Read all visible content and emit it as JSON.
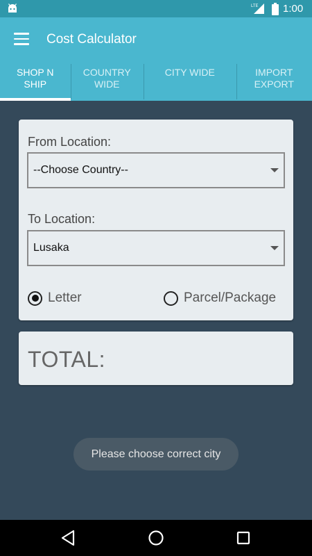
{
  "status_bar": {
    "network": "LTE",
    "time": "1:00"
  },
  "app_bar": {
    "title": "Cost Calculator"
  },
  "tabs": [
    {
      "label": "SHOP N SHIP",
      "active": true
    },
    {
      "label": "COUNTRY WIDE",
      "active": false
    },
    {
      "label": "CITY WIDE",
      "active": false
    },
    {
      "label": "IMPORT EXPORT",
      "active": false
    }
  ],
  "form": {
    "from_label": "From Location:",
    "from_value": "--Choose Country--",
    "to_label": "To Location:",
    "to_value": "Lusaka",
    "radio_letter": "Letter",
    "radio_parcel": "Parcel/Package",
    "selected": "Letter"
  },
  "total": {
    "label": "TOTAL:"
  },
  "toast": {
    "message": "Please choose correct city"
  },
  "colors": {
    "primary": "#4ab7cf",
    "status_bar": "#2f98ab",
    "background": "#34495a",
    "card": "#e8edf0"
  },
  "icons": {
    "status": [
      "android-icon",
      "lte-signal-icon",
      "battery-icon"
    ],
    "app_bar": [
      "menu-icon"
    ],
    "nav": [
      "back-icon",
      "home-icon",
      "recents-icon"
    ]
  }
}
